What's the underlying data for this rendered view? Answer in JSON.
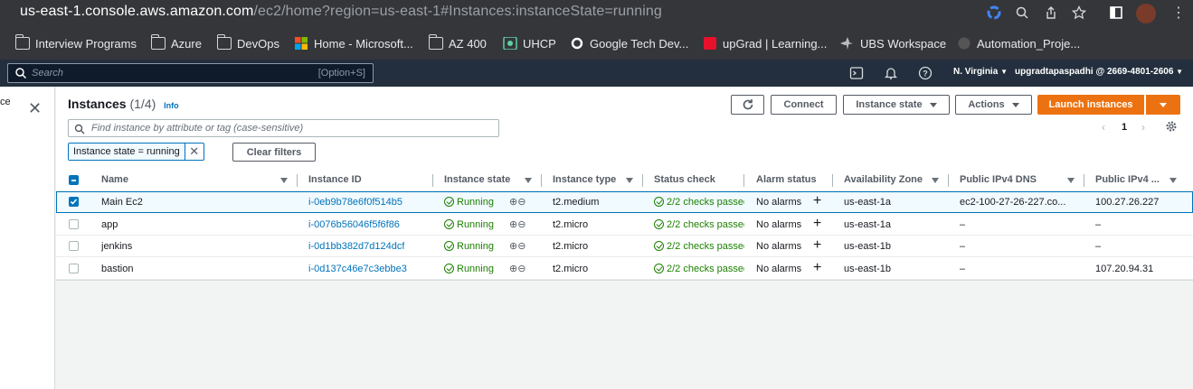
{
  "browser": {
    "url_host": "us-east-1.console.aws.amazon.com",
    "url_path": "/ec2/home?region=us-east-1#Instances:instanceState=running",
    "bookmarks": [
      {
        "label": "Interview Programs",
        "icon": "folder-icon"
      },
      {
        "label": "Azure",
        "icon": "folder-icon"
      },
      {
        "label": "DevOps",
        "icon": "folder-icon"
      },
      {
        "label": "Home - Microsoft...",
        "icon": "microsoft-icon"
      },
      {
        "label": "AZ 400",
        "icon": "folder-icon"
      },
      {
        "label": "UHCP",
        "icon": "uhcp-icon"
      },
      {
        "label": "Google Tech Dev...",
        "icon": "google-icon"
      },
      {
        "label": "upGrad | Learning...",
        "icon": "upgrad-icon"
      },
      {
        "label": "UBS Workspace",
        "icon": "ubs-icon"
      },
      {
        "label": "Automation_Proje...",
        "icon": "github-icon"
      }
    ]
  },
  "aws": {
    "search_placeholder": "Search",
    "search_shortcut": "[Option+S]",
    "region": "N. Virginia",
    "account": "upgradtapaspadhi @ 2669-4801-2606"
  },
  "sidepanel": {
    "truncated_label": "ce"
  },
  "instances": {
    "title": "Instances",
    "count": "(1/4)",
    "info": "Info",
    "buttons": {
      "connect": "Connect",
      "instance_state": "Instance state",
      "actions": "Actions",
      "launch": "Launch instances"
    },
    "filter_placeholder": "Find instance by attribute or tag (case-sensitive)",
    "filter_token": "Instance state = running",
    "clear_filters": "Clear filters",
    "page": "1",
    "columns": [
      "Name",
      "Instance ID",
      "Instance state",
      "Instance type",
      "Status check",
      "Alarm status",
      "Availability Zone",
      "Public IPv4 DNS",
      "Public IPv4 ..."
    ],
    "rows": [
      {
        "selected": true,
        "name": "Main Ec2",
        "id": "i-0eb9b78e6f0f514b5",
        "state": "Running",
        "type": "t2.medium",
        "status": "2/2 checks passed",
        "alarm": "No alarms",
        "az": "us-east-1a",
        "dns": "ec2-100-27-26-227.co...",
        "ip": "100.27.26.227"
      },
      {
        "selected": false,
        "name": "app",
        "id": "i-0076b56046f5f6f86",
        "state": "Running",
        "type": "t2.micro",
        "status": "2/2 checks passed",
        "alarm": "No alarms",
        "az": "us-east-1a",
        "dns": "–",
        "ip": "–"
      },
      {
        "selected": false,
        "name": "jenkins",
        "id": "i-0d1bb382d7d124dcf",
        "state": "Running",
        "type": "t2.micro",
        "status": "2/2 checks passed",
        "alarm": "No alarms",
        "az": "us-east-1b",
        "dns": "–",
        "ip": "–"
      },
      {
        "selected": false,
        "name": "bastion",
        "id": "i-0d137c46e7c3ebbe3",
        "state": "Running",
        "type": "t2.micro",
        "status": "2/2 checks passed",
        "alarm": "No alarms",
        "az": "us-east-1b",
        "dns": "–",
        "ip": "107.20.94.31"
      }
    ]
  },
  "colors": {
    "chrome_bg": "#35363a",
    "aws_nav": "#232f3e",
    "primary_orange": "#ec7211",
    "link_blue": "#0073bb",
    "success_green": "#1d8102"
  }
}
